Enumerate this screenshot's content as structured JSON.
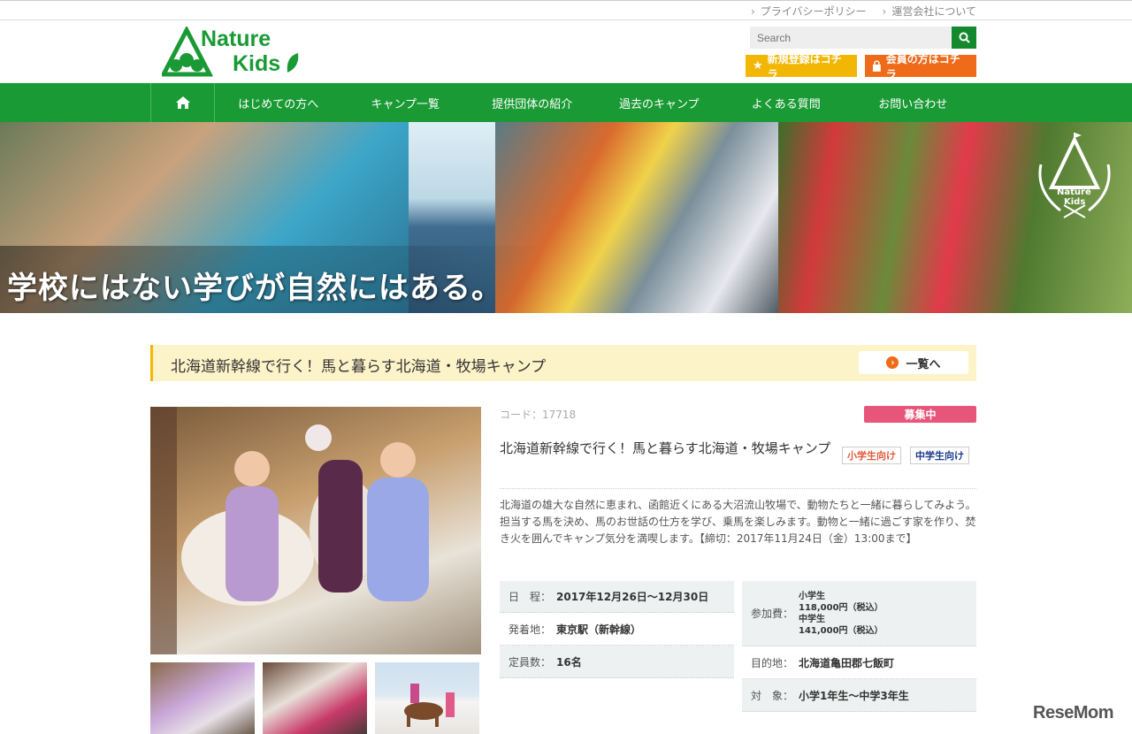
{
  "top_links": [
    "プライバシーポリシー",
    "運営会社について"
  ],
  "logo": {
    "line1": "Nature",
    "line2": "Kids"
  },
  "search": {
    "placeholder": "Search"
  },
  "header_buttons": {
    "register": "新規登録はコチラ",
    "member": "会員の方はコチラ"
  },
  "nav": {
    "items": [
      "はじめての方へ",
      "キャンプ一覧",
      "提供団体の紹介",
      "過去のキャンプ",
      "よくある質問",
      "お問い合わせ"
    ]
  },
  "hero": {
    "slogan": "学校にはない学びが自然にはある。",
    "emblem_line1": "Nature",
    "emblem_line2": "Kids"
  },
  "title_bar": {
    "title": "北海道新幹線で行く！馬と暮らす北海道・牧場キャンプ",
    "list_button": "一覧へ"
  },
  "detail": {
    "code": "コード：17718",
    "status": "募集中",
    "title": "北海道新幹線で行く！馬と暮らす北海道・牧場キャンプ",
    "tags": [
      "小学生向け",
      "中学生向け"
    ],
    "description": "北海道の雄大な自然に恵まれ、函館近くにある大沼流山牧場で、動物たちと一緒に暮らしてみよう。担当する馬を決め、馬のお世話の仕方を学び、乗馬を楽しみます。動物と一緒に過ごす家を作り、焚き火を囲んでキャンプ気分を満喫します。【締切：2017年11月24日（金）13:00まで】"
  },
  "info_left": [
    {
      "key": "日　程：",
      "value": "2017年12月26日〜12月30日"
    },
    {
      "key": "発着地：",
      "value": "東京駅（新幹線）"
    },
    {
      "key": "定員数：",
      "value": "16名"
    }
  ],
  "info_right": [
    {
      "key": "参加費：",
      "lines": [
        "小学生",
        "118,000円（税込）",
        "中学生",
        "141,000円（税込）"
      ]
    },
    {
      "key": "目的地：",
      "value": "北海道亀田郡七飯町"
    },
    {
      "key": "対　象：",
      "value": "小学1年生〜中学3年生"
    }
  ],
  "watermark": "ReseMom",
  "colors": {
    "nav_green": "#1a9a35",
    "register_yellow": "#f2b705",
    "member_orange": "#ef6b1a",
    "status_pink": "#e8557a",
    "title_bg": "#fdf3c8"
  }
}
